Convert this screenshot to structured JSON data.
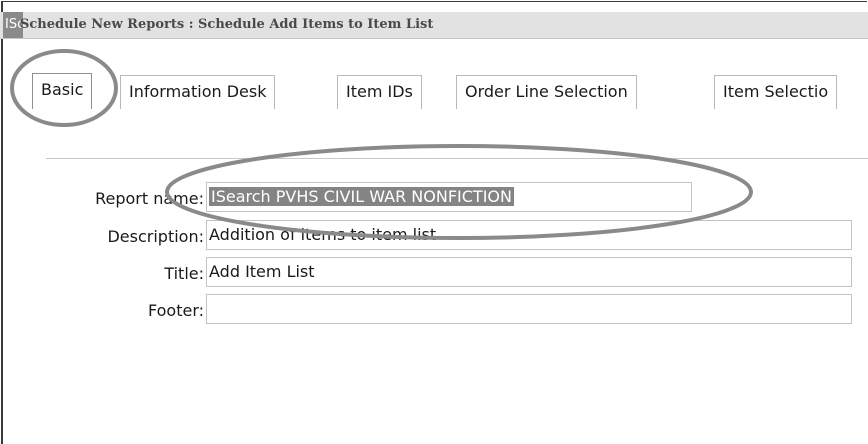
{
  "window": {
    "title_prefix": "ISc",
    "title": "Schedule New Reports : Schedule Add Items to Item List"
  },
  "tabs": [
    {
      "label": "Basic",
      "active": true
    },
    {
      "label": "Information Desk",
      "active": false
    },
    {
      "label": "Item IDs",
      "active": false
    },
    {
      "label": "Order Line Selection",
      "active": false
    },
    {
      "label": "Item Selectio",
      "active": false
    }
  ],
  "form": {
    "report_name": {
      "label": "Report name:",
      "value": "ISearch PVHS CIVIL WAR NONFICTION"
    },
    "description": {
      "label": "Description:",
      "value": "Addition of items to item list"
    },
    "title": {
      "label": "Title:",
      "value": "Add Item List"
    },
    "footer": {
      "label": "Footer:",
      "value": ""
    }
  },
  "colors": {
    "titlebar_bg": "#e2e2e2",
    "selection_bg": "#848484",
    "annotation_stroke": "#8a8a8a"
  }
}
